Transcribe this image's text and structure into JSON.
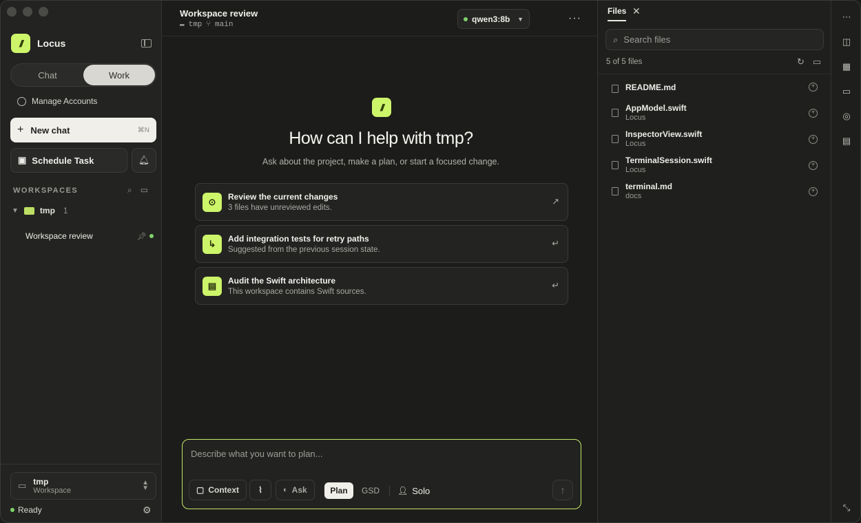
{
  "app": {
    "name": "Locus"
  },
  "sidebar": {
    "segments": [
      {
        "label": "Chat"
      },
      {
        "label": "Work"
      }
    ],
    "manage_accounts": "Manage Accounts",
    "new_chat": {
      "label": "New chat",
      "shortcut": "⌘N"
    },
    "schedule_task": "Schedule Task",
    "workspaces_heading": "WORKSPACES",
    "workspace": {
      "name": "tmp",
      "count": "1"
    },
    "workspace_item": "Workspace review",
    "picker": {
      "name": "tmp",
      "type": "Workspace"
    },
    "status": "Ready"
  },
  "header": {
    "title": "Workspace review",
    "folder": "tmp",
    "branch": "main",
    "model": "qwen3:8b"
  },
  "hero": {
    "title": "How can I help with tmp?",
    "subtitle": "Ask about the project, make a plan, or start a focused change."
  },
  "suggestions": [
    {
      "title": "Review the current changes",
      "subtitle": "3 files have unreviewed edits."
    },
    {
      "title": "Add integration tests for retry paths",
      "subtitle": "Suggested from the previous session state."
    },
    {
      "title": "Audit the Swift architecture",
      "subtitle": "This workspace contains Swift sources."
    }
  ],
  "composer": {
    "placeholder": "Describe what you want to plan...",
    "context": "Context",
    "ask": "Ask",
    "plan": "Plan",
    "gsd": "GSD",
    "solo": "Solo"
  },
  "files_panel": {
    "tab": "Files",
    "search_placeholder": "Search files",
    "count": "5 of 5 files",
    "files": [
      {
        "name": "README.md",
        "dir": ""
      },
      {
        "name": "AppModel.swift",
        "dir": "Locus"
      },
      {
        "name": "InspectorView.swift",
        "dir": "Locus"
      },
      {
        "name": "TerminalSession.swift",
        "dir": "Locus"
      },
      {
        "name": "terminal.md",
        "dir": "docs"
      }
    ]
  },
  "colors": {
    "accent": "#cdf56a",
    "status_green": "#7fd36b"
  }
}
